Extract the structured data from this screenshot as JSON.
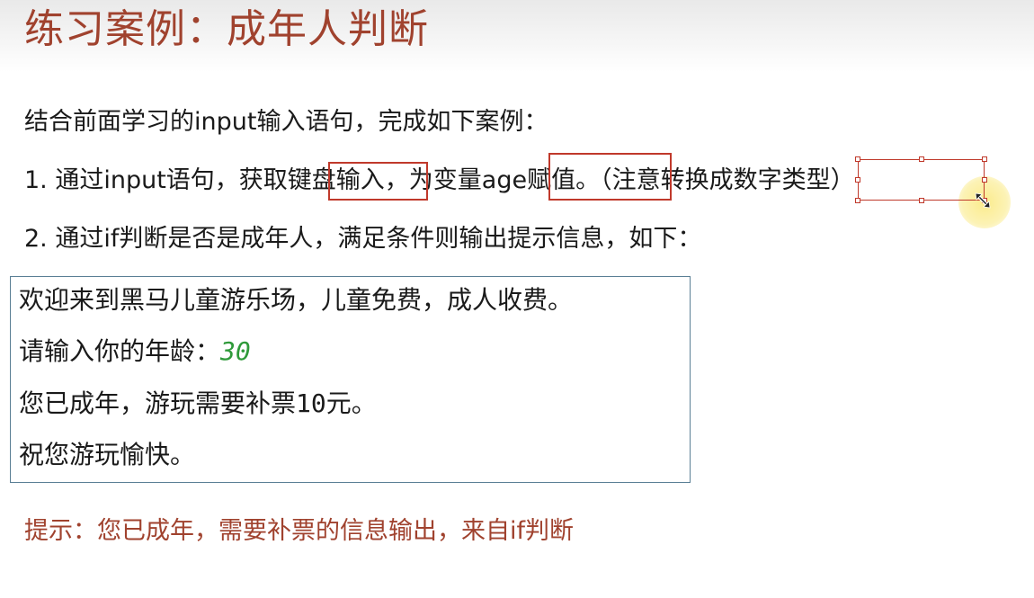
{
  "slide": {
    "title": "练习案例：成年人判断",
    "intro": "结合前面学习的input输入语句，完成如下案例：",
    "steps": [
      {
        "prefix": "1. 通过input语句，获取",
        "highlight_1": "键盘输入",
        "middle": "，为变量",
        "highlight_2": "age赋值",
        "suffix_plain": "。（注意转换成",
        "highlight_3": "数字类型",
        "suffix_end": "）"
      },
      {
        "text": "2. 通过if判断是否是成年人，满足条件则输出提示信息，如下："
      }
    ],
    "output": {
      "line1": "欢迎来到黑马儿童游乐场，儿童免费，成人收费。",
      "line2_prompt": "请输入你的年龄：",
      "line2_value": "30",
      "line3_prefix": "您已成年，游玩需要补票",
      "line3_amount": "10",
      "line3_suffix": "元。",
      "line4": "祝您游玩愉快。"
    },
    "hint": "提示：您已成年，需要补票的信息输出，来自if判断"
  },
  "colors": {
    "title": "#a0422e",
    "highlight_border": "#c0392b",
    "input_value": "#2f9a3a",
    "output_border": "#5a7f95"
  }
}
